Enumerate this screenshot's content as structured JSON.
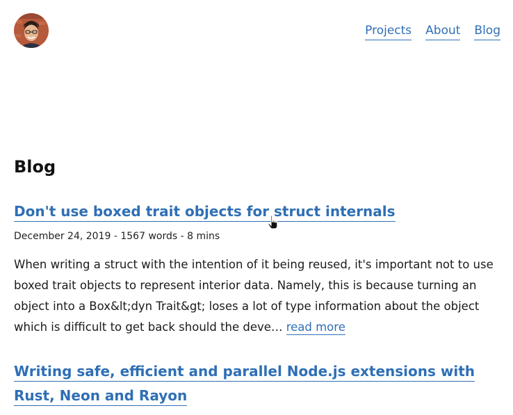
{
  "nav": {
    "links": [
      "Projects",
      "About",
      "Blog"
    ]
  },
  "page": {
    "title": "Blog"
  },
  "posts": [
    {
      "title": "Don't use boxed trait objects for struct internals",
      "date": "December 24, 2019",
      "words": "1567 words",
      "read_time": "8 mins",
      "separator": " - ",
      "excerpt": "When writing a struct with the intention of it being reused, it's important not to use boxed trait objects to represent interior data. Namely, this is because turning an object into a Box&lt;dyn Trait&gt; loses a lot of type information about the object which is difficult to get back should the deve…",
      "read_more": "read more"
    },
    {
      "title": "Writing safe, efficient and parallel Node.js extensions with Rust, Neon and Rayon"
    }
  ],
  "colors": {
    "link": "#2f6fb5",
    "text": "#111111",
    "background": "#ffffff"
  },
  "icons": {
    "avatar": "profile-photo",
    "cursor": "hand-pointer-cursor"
  }
}
